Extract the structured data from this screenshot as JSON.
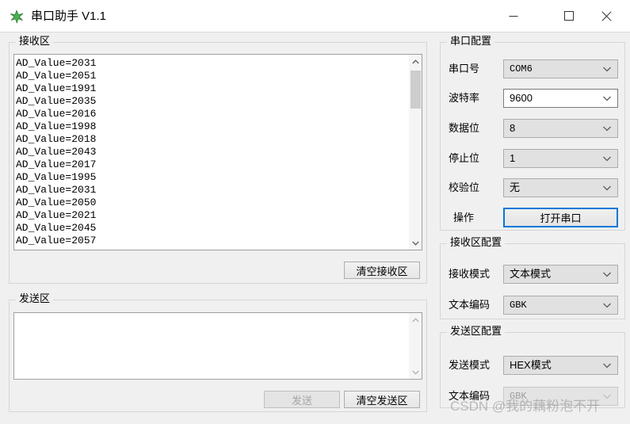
{
  "window": {
    "title": "串口助手 V1.1",
    "icon": "qt-star-icon",
    "controls": {
      "minimize": "minimize-icon",
      "maximize": "maximize-icon",
      "close": "close-icon"
    }
  },
  "receive_area": {
    "group_title": "接收区",
    "content": "AD_Value=2031\nAD_Value=2051\nAD_Value=1991\nAD_Value=2035\nAD_Value=2016\nAD_Value=1998\nAD_Value=2018\nAD_Value=2043\nAD_Value=2017\nAD_Value=1995\nAD_Value=2031\nAD_Value=2050\nAD_Value=2021\nAD_Value=2045\nAD_Value=2057",
    "clear_button": "清空接收区"
  },
  "send_area": {
    "group_title": "发送区",
    "content": "",
    "placeholder": "",
    "send_button": "发送",
    "send_button_enabled": false,
    "clear_button": "清空发送区"
  },
  "serial_config": {
    "group_title": "串口配置",
    "fields": [
      {
        "label": "串口号",
        "value": "COM6",
        "style": "readonly"
      },
      {
        "label": "波特率",
        "value": "9600",
        "style": "editable"
      },
      {
        "label": "数据位",
        "value": "8",
        "style": "readonly"
      },
      {
        "label": "停止位",
        "value": "1",
        "style": "readonly"
      },
      {
        "label": "校验位",
        "value": "无",
        "style": "readonly"
      }
    ],
    "action_label": "操作",
    "action_button": "打开串口",
    "action_button_focused": true
  },
  "receive_config": {
    "group_title": "接收区配置",
    "fields": [
      {
        "label": "接收模式",
        "value": "文本模式",
        "style": "readonly"
      },
      {
        "label": "文本编码",
        "value": "GBK",
        "style": "readonly"
      }
    ]
  },
  "send_config": {
    "group_title": "发送区配置",
    "fields": [
      {
        "label": "发送模式",
        "value": "HEX模式",
        "style": "readonly"
      },
      {
        "label": "文本编码",
        "value": "GBK",
        "style": "disabled"
      }
    ]
  },
  "watermark": "CSDN @我的藕粉泡不开",
  "colors": {
    "window_background": "#f0f0f0",
    "titlebar_background": "#ffffff",
    "accent_focus": "#0078d7",
    "group_border": "#d6d6d6",
    "textbox_border": "#a0a0a0",
    "scroll_thumb": "#cdcdcd",
    "icon_green": "#3d9d4b"
  }
}
